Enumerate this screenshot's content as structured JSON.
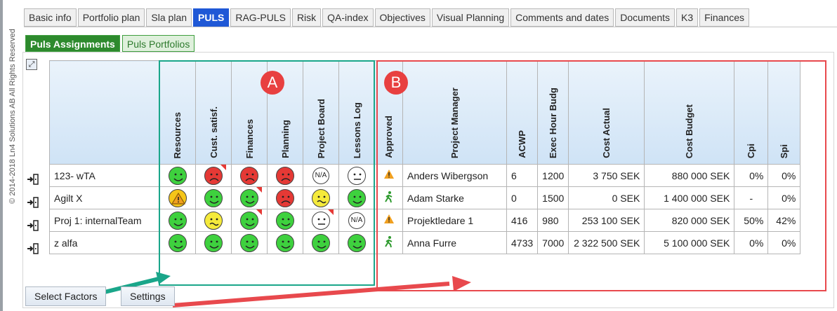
{
  "copyright": "© 2014-2018 Ln4 Solutions AB All Rights Reserved",
  "tabs": [
    "Basic info",
    "Portfolio plan",
    "Sla plan",
    "PULS",
    "RAG-PULS",
    "Risk",
    "QA-index",
    "Objectives",
    "Visual Planning",
    "Comments and dates",
    "Documents",
    "K3",
    "Finances"
  ],
  "active_tab": "PULS",
  "subtabs": [
    "Puls Assignments",
    "Puls Portfolios"
  ],
  "columns": [
    "Resources",
    "Cust. satisf.",
    "Finances",
    "Planning",
    "Project Board",
    "Lessons Log",
    "Approved",
    "Project Manager",
    "ACWP",
    "Exec Hour Budg",
    "Cost Actual",
    "Cost Budget",
    "Cpi",
    "Spi"
  ],
  "rows": [
    {
      "name": "123- wTA",
      "faces": [
        "green",
        "red",
        "red",
        "red",
        "na",
        "white"
      ],
      "approved": "warn",
      "pm": "Anders Wibergson",
      "acwp": "6",
      "exec": "1200",
      "cost_actual": "3 750 SEK",
      "cost_budget": "880 000 SEK",
      "cpi": "0%",
      "spi": "0%"
    },
    {
      "name": "Agilt X",
      "faces": [
        "warn",
        "green",
        "green",
        "red",
        "yellow",
        "green"
      ],
      "approved": "walk",
      "pm": "Adam Starke",
      "acwp": "0",
      "exec": "1500",
      "cost_actual": "0 SEK",
      "cost_budget": "1 400 000 SEK",
      "cpi": "-",
      "spi": "0%"
    },
    {
      "name": "Proj 1: internalTeam",
      "faces": [
        "green",
        "yellow",
        "green",
        "green",
        "white",
        "na"
      ],
      "approved": "warn",
      "pm": "Projektledare 1",
      "acwp": "416",
      "exec": "980",
      "cost_actual": "253 100 SEK",
      "cost_budget": "820 000 SEK",
      "cpi": "50%",
      "spi": "42%"
    },
    {
      "name": "z alfa",
      "faces": [
        "green",
        "green",
        "green",
        "green",
        "green",
        "green"
      ],
      "approved": "walk",
      "pm": "Anna Furre",
      "acwp": "4733",
      "exec": "7000",
      "cost_actual": "2 322 500 SEK",
      "cost_budget": "5 100 000 SEK",
      "cpi": "0%",
      "spi": "0%"
    }
  ],
  "na_label": "N/A",
  "badge_a": "A",
  "badge_b": "B",
  "buttons": {
    "select": "Select Factors",
    "settings": "Settings"
  },
  "colors": {
    "green_box": "#1aa68a",
    "red_box": "#e8494d",
    "active_tab": "#1f58d6"
  }
}
